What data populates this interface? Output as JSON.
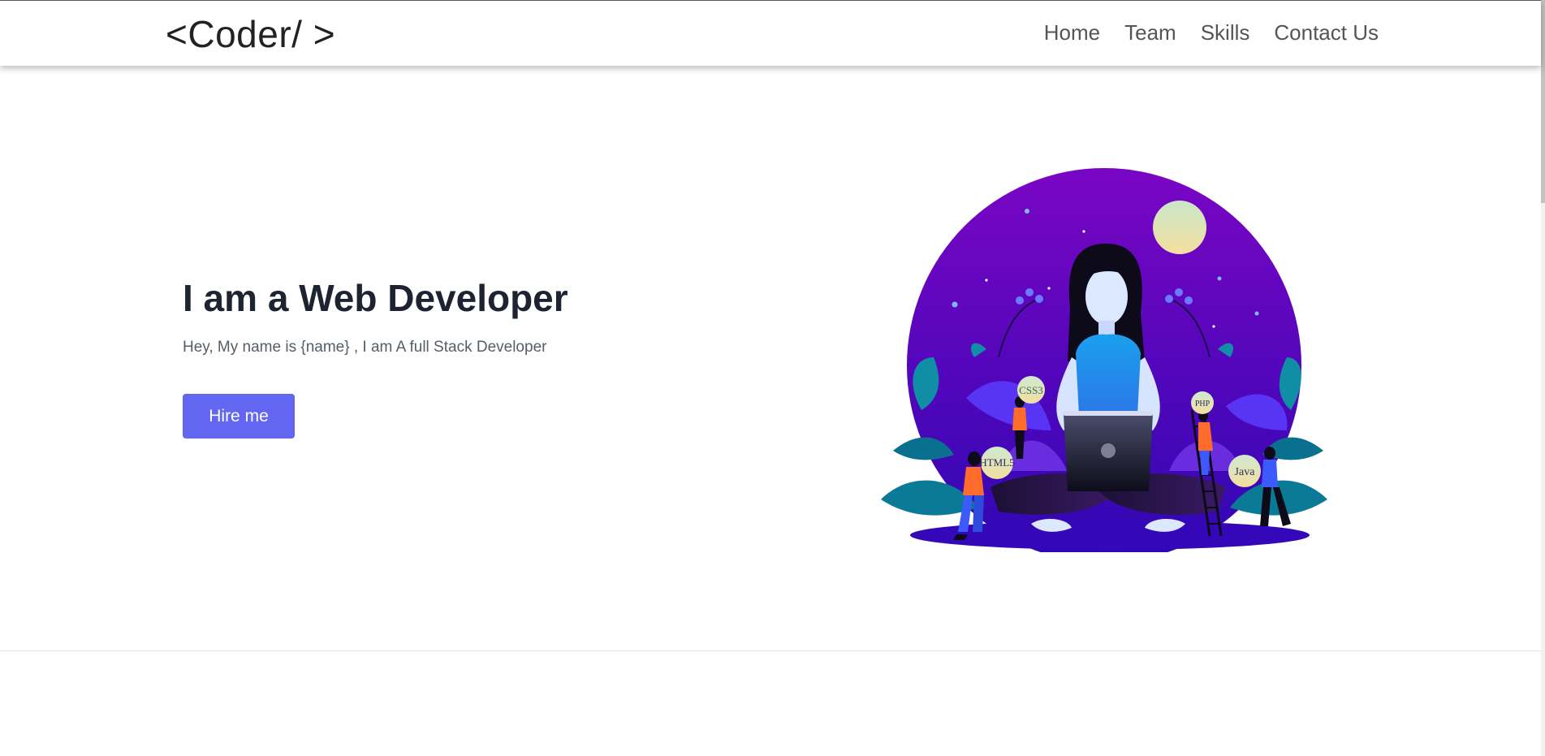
{
  "header": {
    "brand": "<Coder/ >",
    "nav": [
      {
        "label": "Home"
      },
      {
        "label": "Team"
      },
      {
        "label": "Skills"
      },
      {
        "label": "Contact Us"
      }
    ]
  },
  "hero": {
    "title": "I am a Web Developer",
    "subtitle": "Hey, My name is {name} , I am A full Stack Developer",
    "button_label": "Hire me"
  },
  "illustration": {
    "bubbles": [
      "CSS3",
      "PHP",
      "HTML5",
      "Java"
    ]
  },
  "colors": {
    "accent": "#6366f1",
    "circle_top": "#7a06c4",
    "circle_bottom": "#2e07b3",
    "moon": "#f5dfa0"
  }
}
